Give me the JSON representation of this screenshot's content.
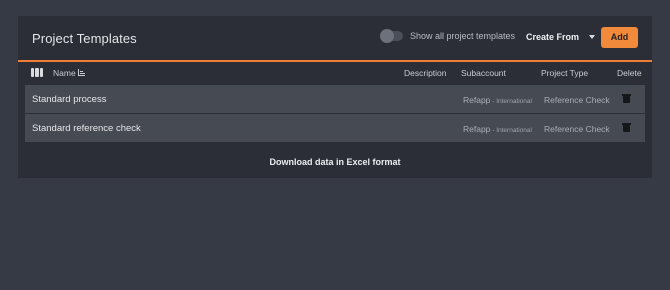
{
  "header": {
    "title": "Project Templates",
    "toggle_label": "Show all project templates",
    "create_from_label": "Create From",
    "add_label": "Add"
  },
  "columns": {
    "name": "Name",
    "description": "Description",
    "subaccount": "Subaccount",
    "project_type": "Project Type",
    "delete": "Delete"
  },
  "rows": [
    {
      "name": "Standard process",
      "subaccount": "Refapp",
      "subaccount_detail": " - International",
      "project_type": "Reference Check"
    },
    {
      "name": "Standard reference check",
      "subaccount": "Refapp",
      "subaccount_detail": " - International",
      "project_type": "Reference Check"
    }
  ],
  "footer": {
    "download_label": "Download data in Excel format"
  },
  "colors": {
    "accent": "#f07d35",
    "add_button": "#f28a3c",
    "background": "#363a45",
    "panel": "#2b2e36",
    "row": "#464a53"
  },
  "icons": [
    "columns-icon",
    "sort-icon",
    "chevron-down-icon",
    "trash-icon",
    "toggle-switch"
  ]
}
